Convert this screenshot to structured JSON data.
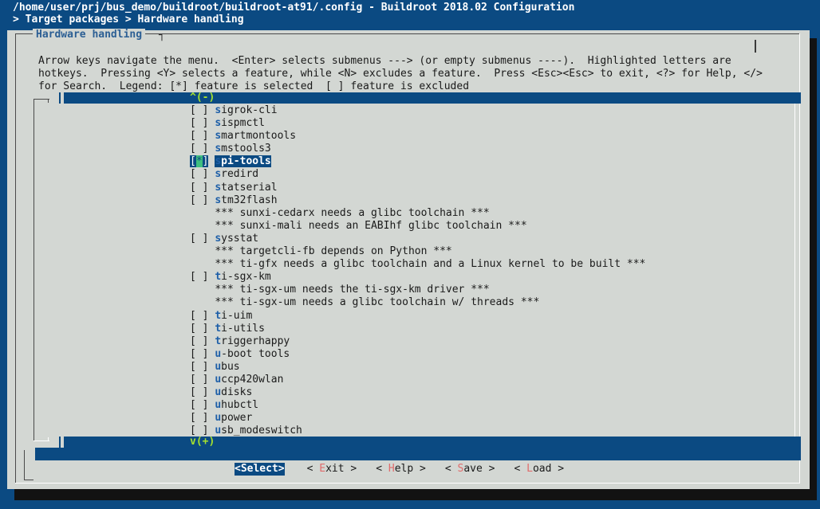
{
  "header": {
    "path_line": "/home/user/prj/bus_demo/buildroot/buildroot-at91/.config - Buildroot 2018.02 Configuration",
    "breadcrumb": "> Target packages > Hardware handling"
  },
  "dialog": {
    "title": "Hardware handling",
    "help_lines": [
      "Arrow keys navigate the menu.  <Enter> selects submenus ---> (or empty submenus ----).  Highlighted letters are",
      "hotkeys.  Pressing <Y> selects a feature, while <N> excludes a feature.  Press <Esc><Esc> to exit, <?> for Help, </>",
      "for Search.  Legend: [*] feature is selected  [ ] feature is excluded"
    ],
    "scroll_up": "^(-)",
    "scroll_down": "v(+)"
  },
  "menu": {
    "items": [
      {
        "box": "[ ]",
        "label": "sigrok-cli",
        "selected": false
      },
      {
        "box": "[ ]",
        "label": "sispmctl",
        "selected": false
      },
      {
        "box": "[ ]",
        "label": "smartmontools",
        "selected": false
      },
      {
        "box": "[ ]",
        "label": "smstools3",
        "selected": false
      },
      {
        "box": "[*]",
        "label": "spi-tools",
        "selected": true
      },
      {
        "box": "[ ]",
        "label": "sredird",
        "selected": false
      },
      {
        "box": "[ ]",
        "label": "statserial",
        "selected": false
      },
      {
        "box": "[ ]",
        "label": "stm32flash",
        "selected": false
      },
      {
        "comment": "*** sunxi-cedarx needs a glibc toolchain ***"
      },
      {
        "comment": "*** sunxi-mali needs an EABIhf glibc toolchain ***"
      },
      {
        "box": "[ ]",
        "label": "sysstat",
        "selected": false
      },
      {
        "comment": "*** targetcli-fb depends on Python ***"
      },
      {
        "comment": "*** ti-gfx needs a glibc toolchain and a Linux kernel to be built ***"
      },
      {
        "box": "[ ]",
        "label": "ti-sgx-km",
        "selected": false
      },
      {
        "comment": "*** ti-sgx-um needs the ti-sgx-km driver ***"
      },
      {
        "comment": "*** ti-sgx-um needs a glibc toolchain w/ threads ***"
      },
      {
        "box": "[ ]",
        "label": "ti-uim",
        "selected": false
      },
      {
        "box": "[ ]",
        "label": "ti-utils",
        "selected": false
      },
      {
        "box": "[ ]",
        "label": "triggerhappy",
        "selected": false
      },
      {
        "box": "[ ]",
        "label": "u-boot tools",
        "selected": false
      },
      {
        "box": "[ ]",
        "label": "ubus",
        "selected": false
      },
      {
        "box": "[ ]",
        "label": "uccp420wlan",
        "selected": false
      },
      {
        "box": "[ ]",
        "label": "udisks",
        "selected": false
      },
      {
        "box": "[ ]",
        "label": "uhubctl",
        "selected": false
      },
      {
        "box": "[ ]",
        "label": "upower",
        "selected": false
      },
      {
        "box": "[ ]",
        "label": "usb_modeswitch",
        "selected": false
      }
    ]
  },
  "buttons": [
    {
      "label": "<Select>",
      "active": true
    },
    {
      "label": "< Exit >",
      "active": false
    },
    {
      "label": "< Help >",
      "active": false
    },
    {
      "label": "< Save >",
      "active": false
    },
    {
      "label": "< Load >",
      "active": false
    }
  ],
  "colors": {
    "background": "#0b4a82",
    "dialog": "#d3d7d3",
    "hotkey": "#1e5fa8",
    "button_hotkey": "#e06c6c",
    "scroll_indicator": "#a6e22e"
  }
}
